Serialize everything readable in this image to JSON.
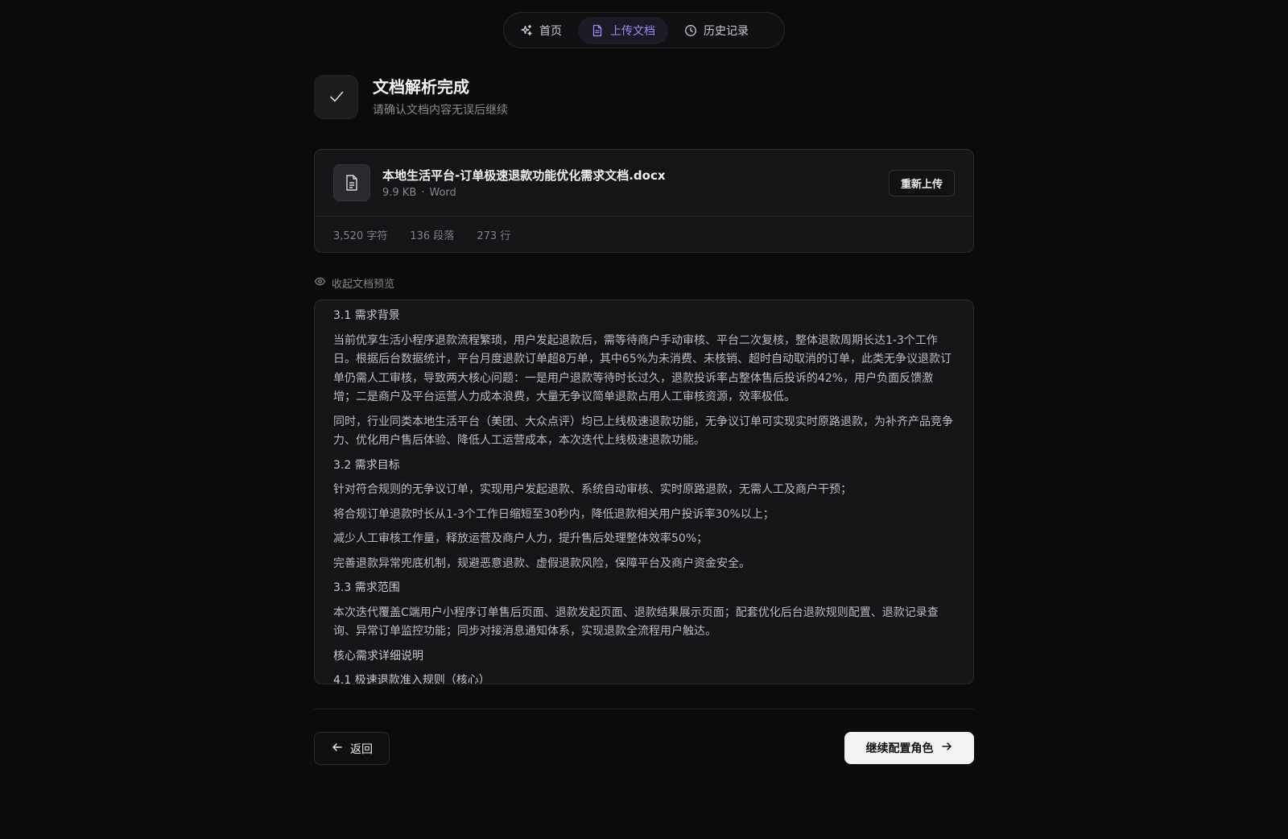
{
  "nav": {
    "items": [
      {
        "label": "首页",
        "icon": "sparkle-icon",
        "active": false
      },
      {
        "label": "上传文档",
        "icon": "document-icon",
        "active": true
      },
      {
        "label": "历史记录",
        "icon": "clock-icon",
        "active": false
      }
    ]
  },
  "header": {
    "title": "文档解析完成",
    "subtitle": "请确认文档内容无误后继续",
    "icon": "check-icon"
  },
  "file": {
    "name": "本地生活平台-订单极速退款功能优化需求文档.docx",
    "size": "9.9 KB",
    "separator": "·",
    "type": "Word",
    "reupload_label": "重新上传",
    "stats": {
      "chars": "3,520 字符",
      "paragraphs": "136 段落",
      "lines": "273 行"
    }
  },
  "preview": {
    "toggle_label": "收起文档预览",
    "paragraphs": [
      {
        "text": "3.1 需求背景",
        "head": true
      },
      {
        "text": "当前优享生活小程序退款流程繁琐，用户发起退款后，需等待商户手动审核、平台二次复核，整体退款周期长达1-3个工作日。根据后台数据统计，平台月度退款订单超8万单，其中65%为未消费、未核销、超时自动取消的订单，此类无争议退款订单仍需人工审核，导致两大核心问题：一是用户退款等待时长过久，退款投诉率占整体售后投诉的42%，用户负面反馈激增；二是商户及平台运营人力成本浪费，大量无争议简单退款占用人工审核资源，效率极低。",
        "head": false
      },
      {
        "text": "同时，行业同类本地生活平台（美团、大众点评）均已上线极速退款功能，无争议订单可实现实时原路退款，为补齐产品竞争力、优化用户售后体验、降低人工运营成本，本次迭代上线极速退款功能。",
        "head": false
      },
      {
        "text": "3.2 需求目标",
        "head": true
      },
      {
        "text": "针对符合规则的无争议订单，实现用户发起退款、系统自动审核、实时原路退款，无需人工及商户干预；",
        "head": false
      },
      {
        "text": "将合规订单退款时长从1-3个工作日缩短至30秒内，降低退款相关用户投诉率30%以上；",
        "head": false
      },
      {
        "text": "减少人工审核工作量，释放运营及商户人力，提升售后处理整体效率50%；",
        "head": false
      },
      {
        "text": "完善退款异常兜底机制，规避恶意退款、虚假退款风险，保障平台及商户资金安全。",
        "head": false
      },
      {
        "text": "3.3 需求范围",
        "head": true
      },
      {
        "text": "本次迭代覆盖C端用户小程序订单售后页面、退款发起页面、退款结果展示页面；配套优化后台退款规则配置、退款记录查询、异常订单监控功能；同步对接消息通知体系，实现退款全流程用户触达。",
        "head": false
      },
      {
        "text": "核心需求详细说明",
        "head": true
      },
      {
        "text": "4.1 极速退款准入规则（核心）",
        "head": true
      }
    ]
  },
  "footer": {
    "back_label": "返回",
    "continue_label": "继续配置角色"
  },
  "colors": {
    "background": "#0b0b0c",
    "accent": "#9b8cf0",
    "primary_button": "#f2f2f4"
  }
}
